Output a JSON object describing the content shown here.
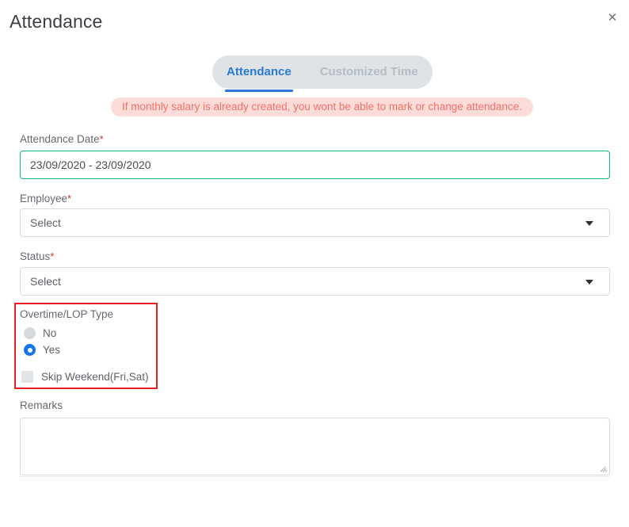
{
  "modal": {
    "title": "Attendance",
    "close_icon": "close-icon",
    "close_glyph": "✕"
  },
  "tabs": [
    {
      "label": "Attendance",
      "active": true
    },
    {
      "label": "Customized Time",
      "active": false
    }
  ],
  "alert": {
    "text": "If monthly salary is already created, you wont be able to mark or change attendance.",
    "bg_color": "#fcdcd8",
    "text_color": "#f47068"
  },
  "form": {
    "attendance_date": {
      "label": "Attendance Date",
      "required_marker": "*",
      "value": "23/09/2020 - 23/09/2020",
      "placeholder": "23/09/2020 - 23/09/2020",
      "border_color": "#12b488"
    },
    "employee": {
      "label": "Employee",
      "required_marker": "*",
      "value": "Select",
      "arrow_icon": "chevron-down-icon"
    },
    "status": {
      "label": "Status",
      "required_marker": "*",
      "value": "Select",
      "arrow_icon": "chevron-down-icon"
    },
    "overtime_lop": {
      "label": "Overtime/LOP Type",
      "highlight_color": "#ee1c25",
      "options": [
        {
          "label": "No",
          "selected": false
        },
        {
          "label": "Yes",
          "selected": true
        }
      ],
      "skip_weekend": {
        "label": "Skip Weekend(Fri,Sat)",
        "checked": false
      }
    },
    "remarks": {
      "label": "Remarks",
      "value": "",
      "placeholder": ""
    }
  }
}
